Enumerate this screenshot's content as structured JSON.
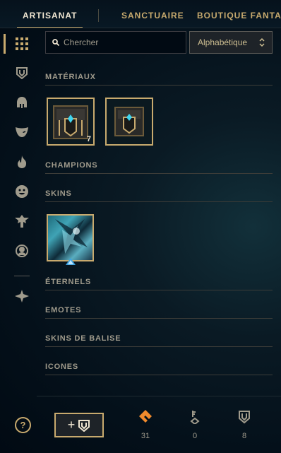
{
  "nav": {
    "tabs": [
      {
        "label": "ARTISANAT",
        "active": true
      },
      {
        "label": "SANCTUAIRE",
        "active": false
      },
      {
        "label": "BOUTIQUE FANTAS",
        "active": false
      }
    ]
  },
  "sidebar": {
    "icons": [
      "grid-icon",
      "chest-icon",
      "helmet-icon",
      "mask-icon",
      "flame-icon",
      "emote-face-icon",
      "ward-icon",
      "profile-icon",
      "eternals-icon"
    ]
  },
  "search": {
    "placeholder": "Chercher",
    "value": ""
  },
  "sort": {
    "selected": "Alphabétique"
  },
  "sections": {
    "materiaux": "MATÉRIAUX",
    "champions": "CHAMPIONS",
    "skins": "SKINS",
    "eternels": "ÉTERNELS",
    "emotes": "EMOTES",
    "skins_balise": "SKINS DE BALISE",
    "icones": "ICONES"
  },
  "materials": [
    {
      "name": "hextech-chest",
      "count": "7"
    },
    {
      "name": "hextech-chest-2",
      "count": ""
    }
  ],
  "skins": [
    {
      "name": "skin-shard"
    }
  ],
  "bottom": {
    "help": "?",
    "craft_label": "+",
    "currencies": [
      {
        "name": "orange-essence",
        "value": "31",
        "color": "#f08a2c"
      },
      {
        "name": "key-fragment",
        "value": "0",
        "color": "#a09b8c"
      },
      {
        "name": "chest",
        "value": "8",
        "color": "#a09b8c"
      }
    ]
  },
  "colors": {
    "gold": "#c8aa6e",
    "text": "#a09b8c",
    "background": "#010a13"
  }
}
